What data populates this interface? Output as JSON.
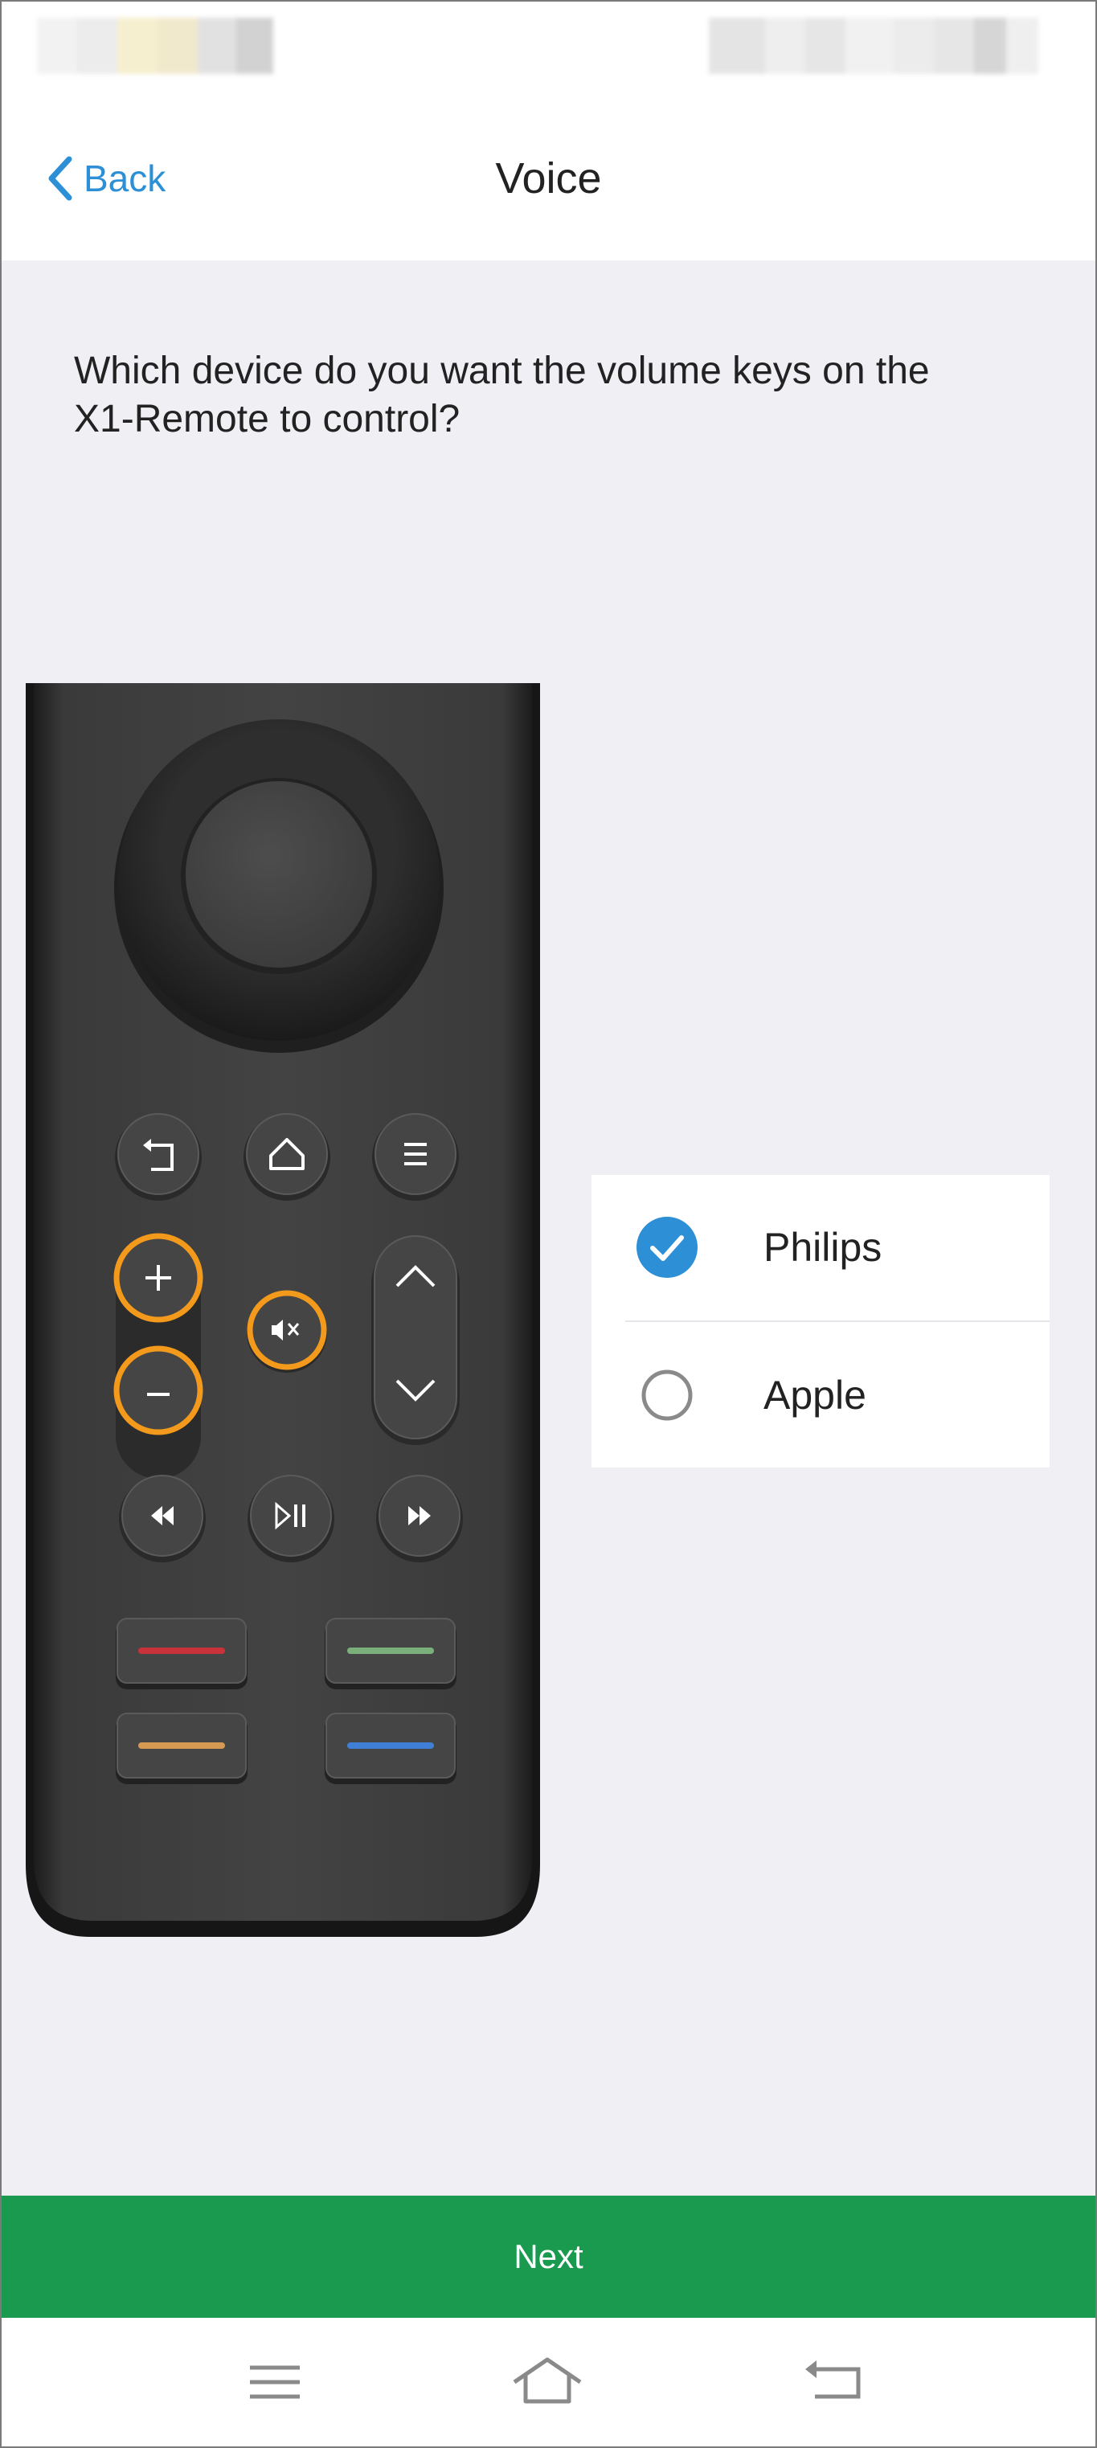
{
  "nav": {
    "back_label": "Back",
    "title": "Voice"
  },
  "question": "Which device do you want the volume keys on the X1-Remote to control?",
  "options": [
    {
      "label": "Philips",
      "selected": true
    },
    {
      "label": "Apple",
      "selected": false
    }
  ],
  "next_label": "Next",
  "colors": {
    "accent_blue": "#2d8fd5",
    "next_green": "#1a9a4e",
    "highlight_orange": "#f39a1c",
    "background": "#efeff4"
  },
  "icons": {
    "back": "chevron-left-icon",
    "radio_on": "check-circle-icon",
    "radio_off": "empty-circle-icon",
    "system_menu": "menu-icon",
    "system_home": "home-icon",
    "system_back": "return-icon"
  }
}
